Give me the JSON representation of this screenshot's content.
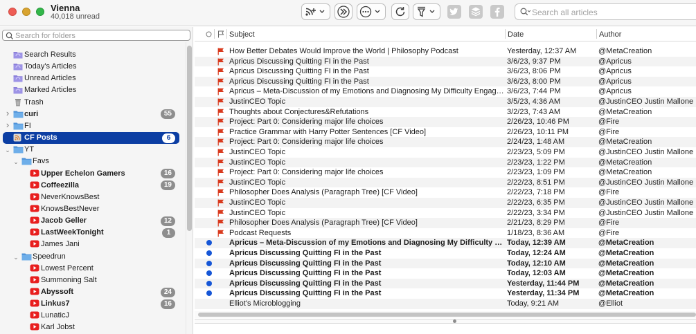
{
  "app": {
    "title": "Vienna",
    "subtitle": "40,018 unread"
  },
  "toolbar": {
    "buttons": [
      {
        "name": "subscribe-menu-button",
        "icon": "rss-plus-icon"
      },
      {
        "name": "skip-to-next-unread-button",
        "icon": "double-chevron-right-icon"
      },
      {
        "name": "actions-menu-button",
        "icon": "ellipsis-circle-icon"
      },
      {
        "name": "refresh-button",
        "icon": "refresh-icon"
      },
      {
        "name": "filter-menu-button",
        "icon": "funnel-icon"
      },
      {
        "name": "share-twitter-button",
        "icon": "twitter-icon"
      },
      {
        "name": "share-buffer-button",
        "icon": "buffer-layers-icon"
      },
      {
        "name": "share-facebook-button",
        "icon": "facebook-icon"
      }
    ],
    "search_placeholder": "Search all articles"
  },
  "sidebar": {
    "search_placeholder": "Search for folders",
    "items": [
      {
        "label": "Search Results",
        "icon": "smart-folder-icon",
        "level": 0,
        "bold": false
      },
      {
        "label": "Today's Articles",
        "icon": "smart-folder-icon",
        "level": 0,
        "bold": false
      },
      {
        "label": "Unread Articles",
        "icon": "smart-folder-icon",
        "level": 0,
        "bold": false
      },
      {
        "label": "Marked Articles",
        "icon": "smart-folder-icon",
        "level": 0,
        "bold": false
      },
      {
        "label": "Trash",
        "icon": "trash-icon",
        "level": 0,
        "bold": false
      },
      {
        "label": "curi",
        "icon": "folder-icon",
        "level": 0,
        "bold": true,
        "badge": "55",
        "disclosure": "collapsed"
      },
      {
        "label": "FI",
        "icon": "folder-icon",
        "level": 0,
        "bold": false,
        "disclosure": "collapsed"
      },
      {
        "label": "CF Posts",
        "icon": "rss-feed-icon",
        "level": 0,
        "bold": true,
        "badge": "6",
        "selected": true
      },
      {
        "label": "YT",
        "icon": "folder-icon",
        "level": 0,
        "bold": false,
        "disclosure": "expanded"
      },
      {
        "label": "Favs",
        "icon": "folder-icon",
        "level": 1,
        "bold": false,
        "disclosure": "expanded"
      },
      {
        "label": "Upper Echelon Gamers",
        "icon": "youtube-icon",
        "level": 2,
        "bold": true,
        "badge": "16"
      },
      {
        "label": "Coffeezilla",
        "icon": "youtube-icon",
        "level": 2,
        "bold": true,
        "badge": "19"
      },
      {
        "label": "NeverKnowsBest",
        "icon": "youtube-icon",
        "level": 2,
        "bold": false
      },
      {
        "label": "KnowsBestNever",
        "icon": "youtube-icon",
        "level": 2,
        "bold": false
      },
      {
        "label": "Jacob Geller",
        "icon": "youtube-icon",
        "level": 2,
        "bold": true,
        "badge": "12"
      },
      {
        "label": "LastWeekTonight",
        "icon": "youtube-icon",
        "level": 2,
        "bold": true,
        "badge": "1"
      },
      {
        "label": "James Jani",
        "icon": "youtube-icon",
        "level": 2,
        "bold": false
      },
      {
        "label": "Speedrun",
        "icon": "folder-icon",
        "level": 1,
        "bold": false,
        "disclosure": "expanded"
      },
      {
        "label": "Lowest Percent",
        "icon": "youtube-icon",
        "level": 2,
        "bold": false
      },
      {
        "label": "Summoning Salt",
        "icon": "youtube-icon",
        "level": 2,
        "bold": false
      },
      {
        "label": "Abyssoft",
        "icon": "youtube-icon",
        "level": 2,
        "bold": true,
        "badge": "24"
      },
      {
        "label": "Linkus7",
        "icon": "youtube-icon",
        "level": 2,
        "bold": true,
        "badge": "16"
      },
      {
        "label": "LunaticJ",
        "icon": "youtube-icon",
        "level": 2,
        "bold": false
      },
      {
        "label": "Karl Jobst",
        "icon": "youtube-icon",
        "level": 2,
        "bold": false
      }
    ]
  },
  "list": {
    "columns": {
      "subject": "Subject",
      "date": "Date",
      "author": "Author"
    },
    "flag_color": "#d93a1e",
    "unread_dot_color": "#1656d6",
    "articles": [
      {
        "subject": "How Better Debates Would Improve the World | Philosophy Podcast",
        "date": "Yesterday, 12:37 AM",
        "author": "@MetaCreation",
        "flagged": true,
        "unread": false
      },
      {
        "subject": "Apricus Discussing Quitting FI in the Past",
        "date": "3/6/23, 9:37 PM",
        "author": "@Apricus",
        "flagged": true,
        "unread": false
      },
      {
        "subject": "Apricus Discussing Quitting FI in the Past",
        "date": "3/6/23, 8:06 PM",
        "author": "@Apricus",
        "flagged": true,
        "unread": false
      },
      {
        "subject": "Apricus Discussing Quitting FI in the Past",
        "date": "3/6/23, 8:00 PM",
        "author": "@Apricus",
        "flagged": true,
        "unread": false
      },
      {
        "subject": "Apricus – Meta-Discussion of my Emotions and Diagnosing My Difficulty Engaging with Criticism",
        "date": "3/6/23, 7:44 PM",
        "author": "@Apricus",
        "flagged": true,
        "unread": false
      },
      {
        "subject": "JustinCEO Topic",
        "date": "3/5/23, 4:36 AM",
        "author": "@JustinCEO Justin Mallone",
        "flagged": true,
        "unread": false
      },
      {
        "subject": "Thoughts about Conjectures&Refutations",
        "date": "3/2/23, 7:43 AM",
        "author": "@MetaCreation",
        "flagged": true,
        "unread": false
      },
      {
        "subject": "Project: Part 0: Considering major life choices",
        "date": "2/26/23, 10:46 PM",
        "author": "@Fire",
        "flagged": true,
        "unread": false
      },
      {
        "subject": "Practice Grammar with Harry Potter Sentences [CF Video]",
        "date": "2/26/23, 10:11 PM",
        "author": "@Fire",
        "flagged": true,
        "unread": false
      },
      {
        "subject": "Project: Part 0: Considering major life choices",
        "date": "2/24/23, 1:48 AM",
        "author": "@MetaCreation",
        "flagged": true,
        "unread": false
      },
      {
        "subject": "JustinCEO Topic",
        "date": "2/23/23, 5:09 PM",
        "author": "@JustinCEO Justin Mallone",
        "flagged": true,
        "unread": false
      },
      {
        "subject": "JustinCEO Topic",
        "date": "2/23/23, 1:22 PM",
        "author": "@MetaCreation",
        "flagged": true,
        "unread": false
      },
      {
        "subject": "Project: Part 0: Considering major life choices",
        "date": "2/23/23, 1:09 PM",
        "author": "@MetaCreation",
        "flagged": true,
        "unread": false
      },
      {
        "subject": "JustinCEO Topic",
        "date": "2/22/23, 8:51 PM",
        "author": "@JustinCEO Justin Mallone",
        "flagged": true,
        "unread": false
      },
      {
        "subject": "Philosopher Does Analysis (Paragraph Tree) [CF Video]",
        "date": "2/22/23, 7:18 PM",
        "author": "@Fire",
        "flagged": true,
        "unread": false
      },
      {
        "subject": "JustinCEO Topic",
        "date": "2/22/23, 6:35 PM",
        "author": "@JustinCEO Justin Mallone",
        "flagged": true,
        "unread": false
      },
      {
        "subject": "JustinCEO Topic",
        "date": "2/22/23, 3:34 PM",
        "author": "@JustinCEO Justin Mallone",
        "flagged": true,
        "unread": false
      },
      {
        "subject": "Philosopher Does Analysis (Paragraph Tree) [CF Video]",
        "date": "2/21/23, 8:29 PM",
        "author": "@Fire",
        "flagged": true,
        "unread": false
      },
      {
        "subject": "Podcast Requests",
        "date": "1/18/23, 8:36 AM",
        "author": "@Fire",
        "flagged": true,
        "unread": false
      },
      {
        "subject": "Apricus – Meta-Discussion of my Emotions and Diagnosing My Difficulty Engaging with Criticism",
        "date": "Today, 12:39 AM",
        "author": "@MetaCreation",
        "flagged": false,
        "unread": true
      },
      {
        "subject": "Apricus Discussing Quitting FI in the Past",
        "date": "Today, 12:24 AM",
        "author": "@MetaCreation",
        "flagged": false,
        "unread": true
      },
      {
        "subject": "Apricus Discussing Quitting FI in the Past",
        "date": "Today, 12:10 AM",
        "author": "@MetaCreation",
        "flagged": false,
        "unread": true
      },
      {
        "subject": "Apricus Discussing Quitting FI in the Past",
        "date": "Today, 12:03 AM",
        "author": "@MetaCreation",
        "flagged": false,
        "unread": true
      },
      {
        "subject": "Apricus Discussing Quitting FI in the Past",
        "date": "Yesterday, 11:44 PM",
        "author": "@MetaCreation",
        "flagged": false,
        "unread": true
      },
      {
        "subject": "Apricus Discussing Quitting FI in the Past",
        "date": "Yesterday, 11:34 PM",
        "author": "@MetaCreation",
        "flagged": false,
        "unread": true
      },
      {
        "subject": "Elliot's Microblogging",
        "date": "Today, 9:21 AM",
        "author": "@Elliot",
        "flagged": false,
        "unread": false
      }
    ]
  }
}
